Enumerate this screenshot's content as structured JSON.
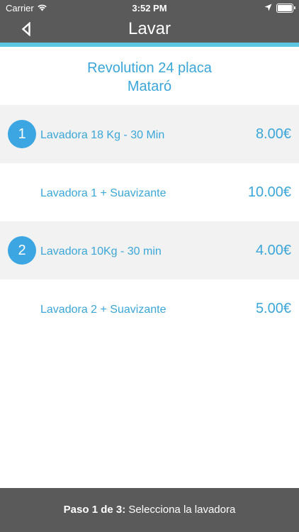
{
  "status_bar": {
    "carrier": "Carrier",
    "time": "3:52 PM",
    "icons": [
      "wifi-icon",
      "location-arrow-icon",
      "battery-icon"
    ]
  },
  "nav": {
    "title": "Lavar",
    "back_icon": "back-triangle-icon"
  },
  "location": {
    "name": "Revolution 24 placa",
    "city": "Mataró"
  },
  "options": [
    {
      "number": "1",
      "label": "Lavadora 18 Kg - 30 Min",
      "price": "8.00€"
    },
    {
      "number": "",
      "label": "Lavadora 1 + Suavizante",
      "price": "10.00€"
    },
    {
      "number": "2",
      "label": "Lavadora 10Kg - 30 min",
      "price": "4.00€"
    },
    {
      "number": "",
      "label": "Lavadora 2 + Suavizante",
      "price": "5.00€"
    }
  ],
  "footer": {
    "step": "Paso 1 de 3:",
    "instruction": "Selecciona la lavadora"
  },
  "colors": {
    "bar": "#5a5a5a",
    "accent_strip": "#5bc5e2",
    "text_blue": "#3ba6d9",
    "badge": "#3ba6e2",
    "row_shade": "#f2f2f2"
  }
}
